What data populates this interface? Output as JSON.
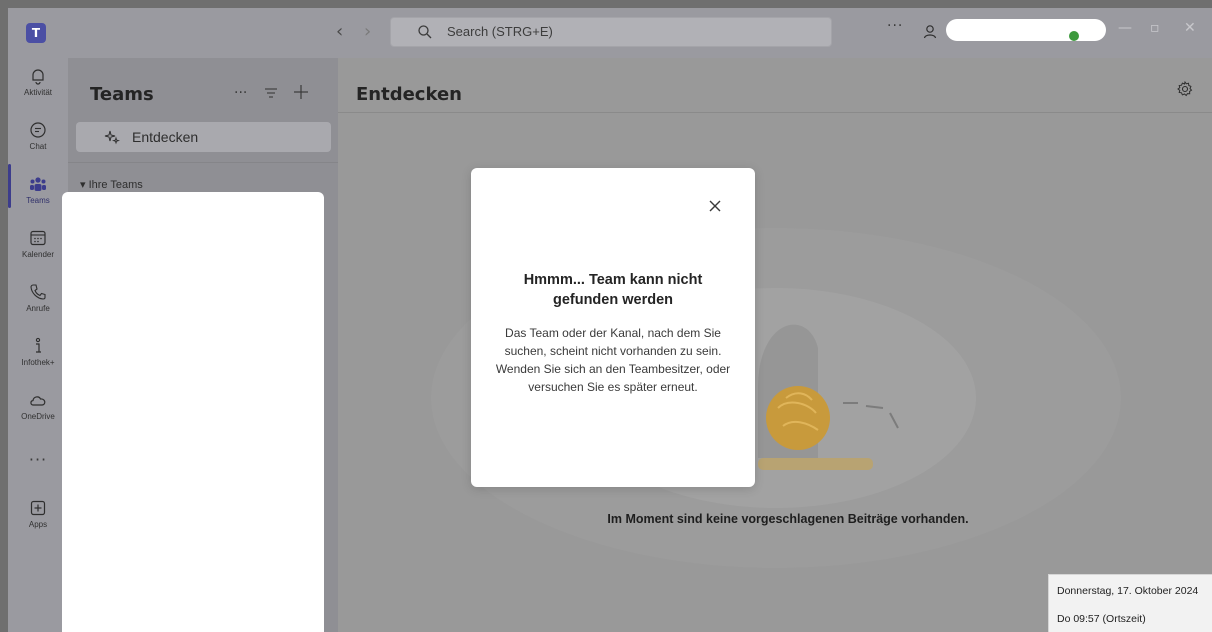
{
  "app": {
    "logo_icon": "teams-logo-icon",
    "search": {
      "placeholder": "Search (STRG+E)"
    },
    "title_more": "···"
  },
  "rail": {
    "items": [
      {
        "label": "Aktivität",
        "icon": "bell-icon"
      },
      {
        "label": "Chat",
        "icon": "chat-icon"
      },
      {
        "label": "Teams",
        "icon": "teams-icon",
        "active": true
      },
      {
        "label": "Kalender",
        "icon": "calendar-icon"
      },
      {
        "label": "Anrufe",
        "icon": "phone-icon"
      },
      {
        "label": "Infothek+",
        "icon": "info-icon"
      },
      {
        "label": "OneDrive",
        "icon": "cloud-icon"
      },
      {
        "label": "···",
        "icon": "more-icon"
      },
      {
        "label": "Apps",
        "icon": "add-apps-icon"
      }
    ]
  },
  "teams_panel": {
    "title": "Teams",
    "more": "···",
    "discover_label": "Entdecken",
    "your_teams": "▾ Ihre Teams"
  },
  "main": {
    "title": "Entdecken",
    "empty_message": "Im Moment sind keine vorgeschlagenen Beiträge vorhanden."
  },
  "modal": {
    "title": "Hmmm... Team kann nicht gefunden werden",
    "body": "Das Team oder der Kanal, nach dem Sie suchen, scheint nicht vorhanden zu sein. Wenden Sie sich an den Teambesitzer, oder versuchen Sie es später erneut."
  },
  "clock": {
    "date": "Donnerstag, 17. Oktober 2024",
    "time": "Do 09:57 (Ortszeit)"
  },
  "colors": {
    "accent": "#4b4fa4",
    "status_available": "#3d9a3d"
  }
}
